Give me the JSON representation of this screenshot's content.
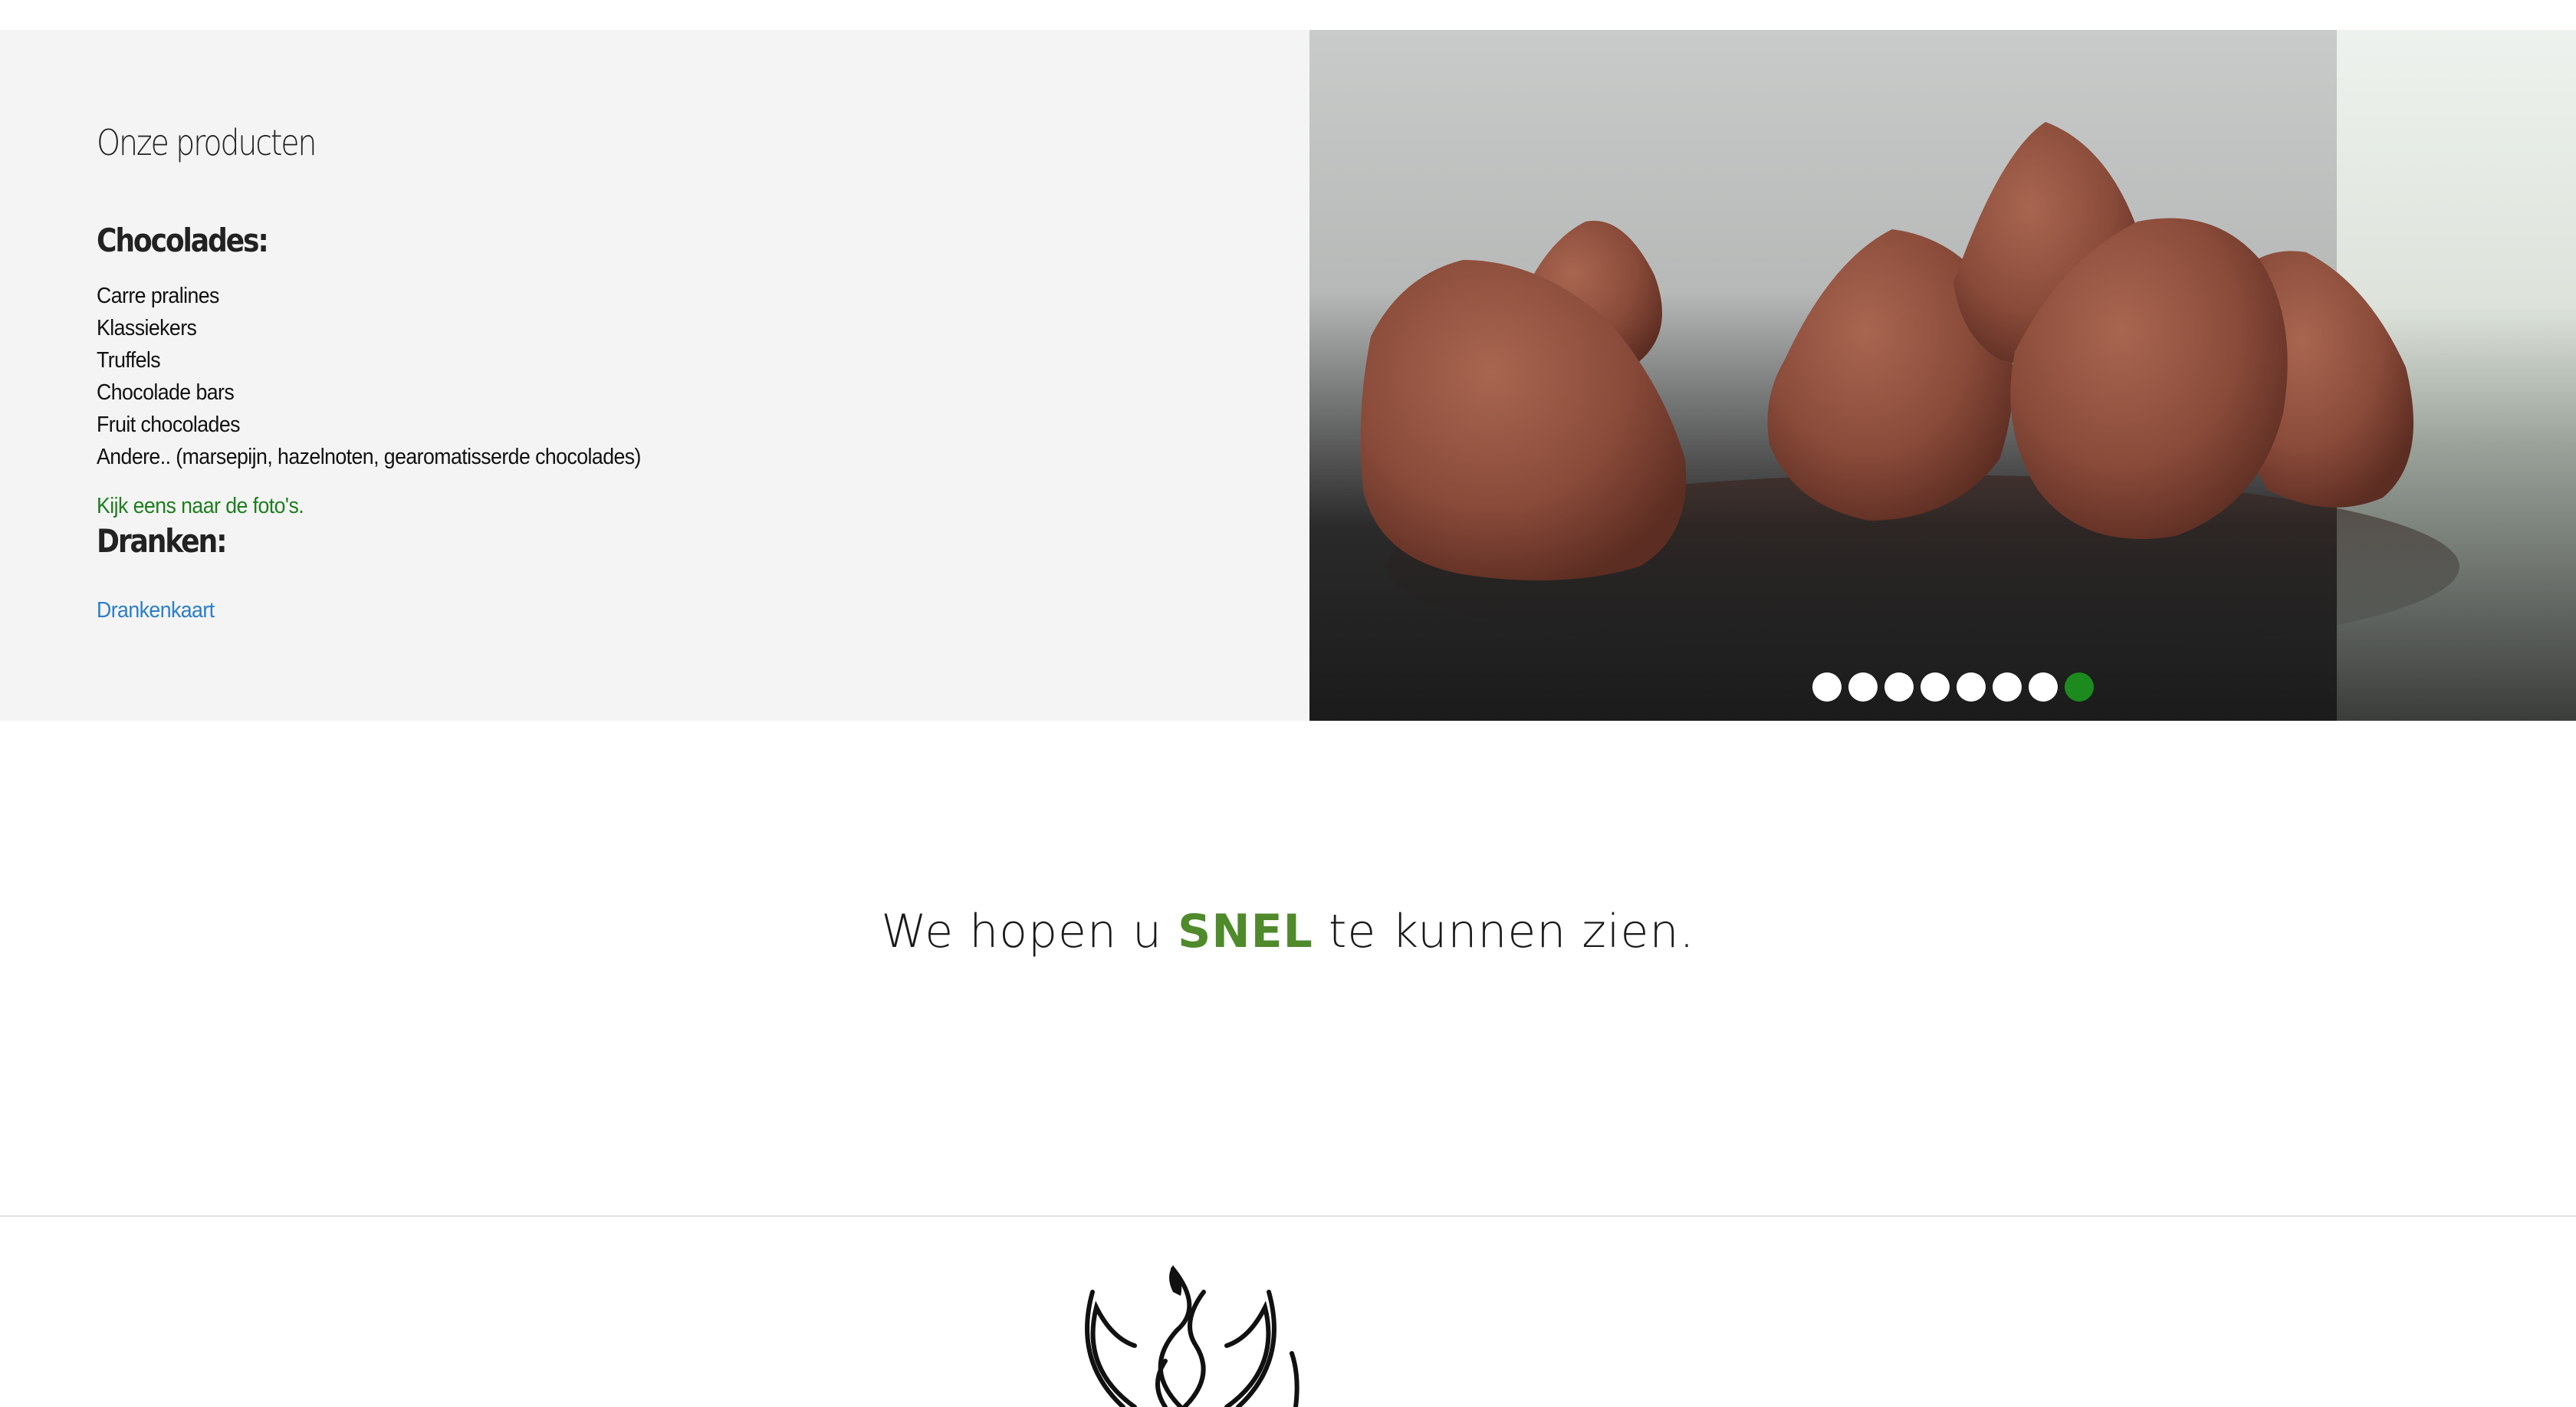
{
  "products": {
    "title": "Onze producten",
    "chocolades_heading": "Chocolades:",
    "chocolades_items": [
      "Carre pralines",
      "Klassiekers",
      "Truffels",
      "Chocolade bars",
      "Fruit chocolades",
      "Andere.. (marsepijn, hazelnoten, gearomatisserde chocolades)"
    ],
    "photos_link": "Kijk eens naar de foto's.",
    "dranken_heading": "Dranken:",
    "drinks_link": "Drankenkaart"
  },
  "slider": {
    "image": "chocolate truffles on dark granite",
    "dot_count": 8,
    "active_dot": 8,
    "dot_color": "#ffffff",
    "active_dot_color": "#1d8a1d"
  },
  "tagline": {
    "before": "We hopen u ",
    "highlight": "SNEL",
    "after": " te kunnen zien.",
    "highlight_color": "#4f8a2b"
  },
  "footer": {
    "logo": "leaf-flame-logo"
  }
}
